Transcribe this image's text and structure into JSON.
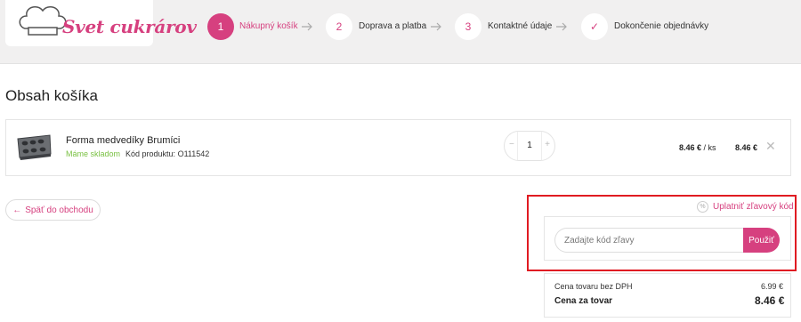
{
  "header": {
    "brand": "Svet cukrárov",
    "steps": [
      {
        "number": "1",
        "label": "Nákupný košík",
        "active": true
      },
      {
        "number": "2",
        "label": "Doprava a platba"
      },
      {
        "number": "3",
        "label": "Kontaktné údaje"
      },
      {
        "number": "✓",
        "label": "Dokončenie objednávky"
      }
    ]
  },
  "page_title": "Obsah košíka",
  "cart": {
    "items": [
      {
        "name": "Forma medvedíky Brumíci",
        "stock": "Máme skladom",
        "code_label": "Kód produktu:",
        "code": "O111542",
        "quantity": "1",
        "unit_price": "8.46 €",
        "unit_suffix": "/ ks",
        "total": "8.46 €"
      }
    ]
  },
  "actions": {
    "back_label": "Späť do obchodu",
    "back_arrow": "←"
  },
  "discount": {
    "toggle_label": "Uplatniť zľavový kód",
    "icon": "%",
    "placeholder": "Zadajte kód zľavy",
    "apply_label": "Použiť"
  },
  "summary": {
    "net_label": "Cena tovaru bez DPH",
    "net_value": "6.99 €",
    "total_label": "Cena za tovar",
    "total_value": "8.46 €"
  },
  "colors": {
    "accent": "#d6407f",
    "in_stock": "#7ac143",
    "highlight_border": "#e01b22"
  }
}
